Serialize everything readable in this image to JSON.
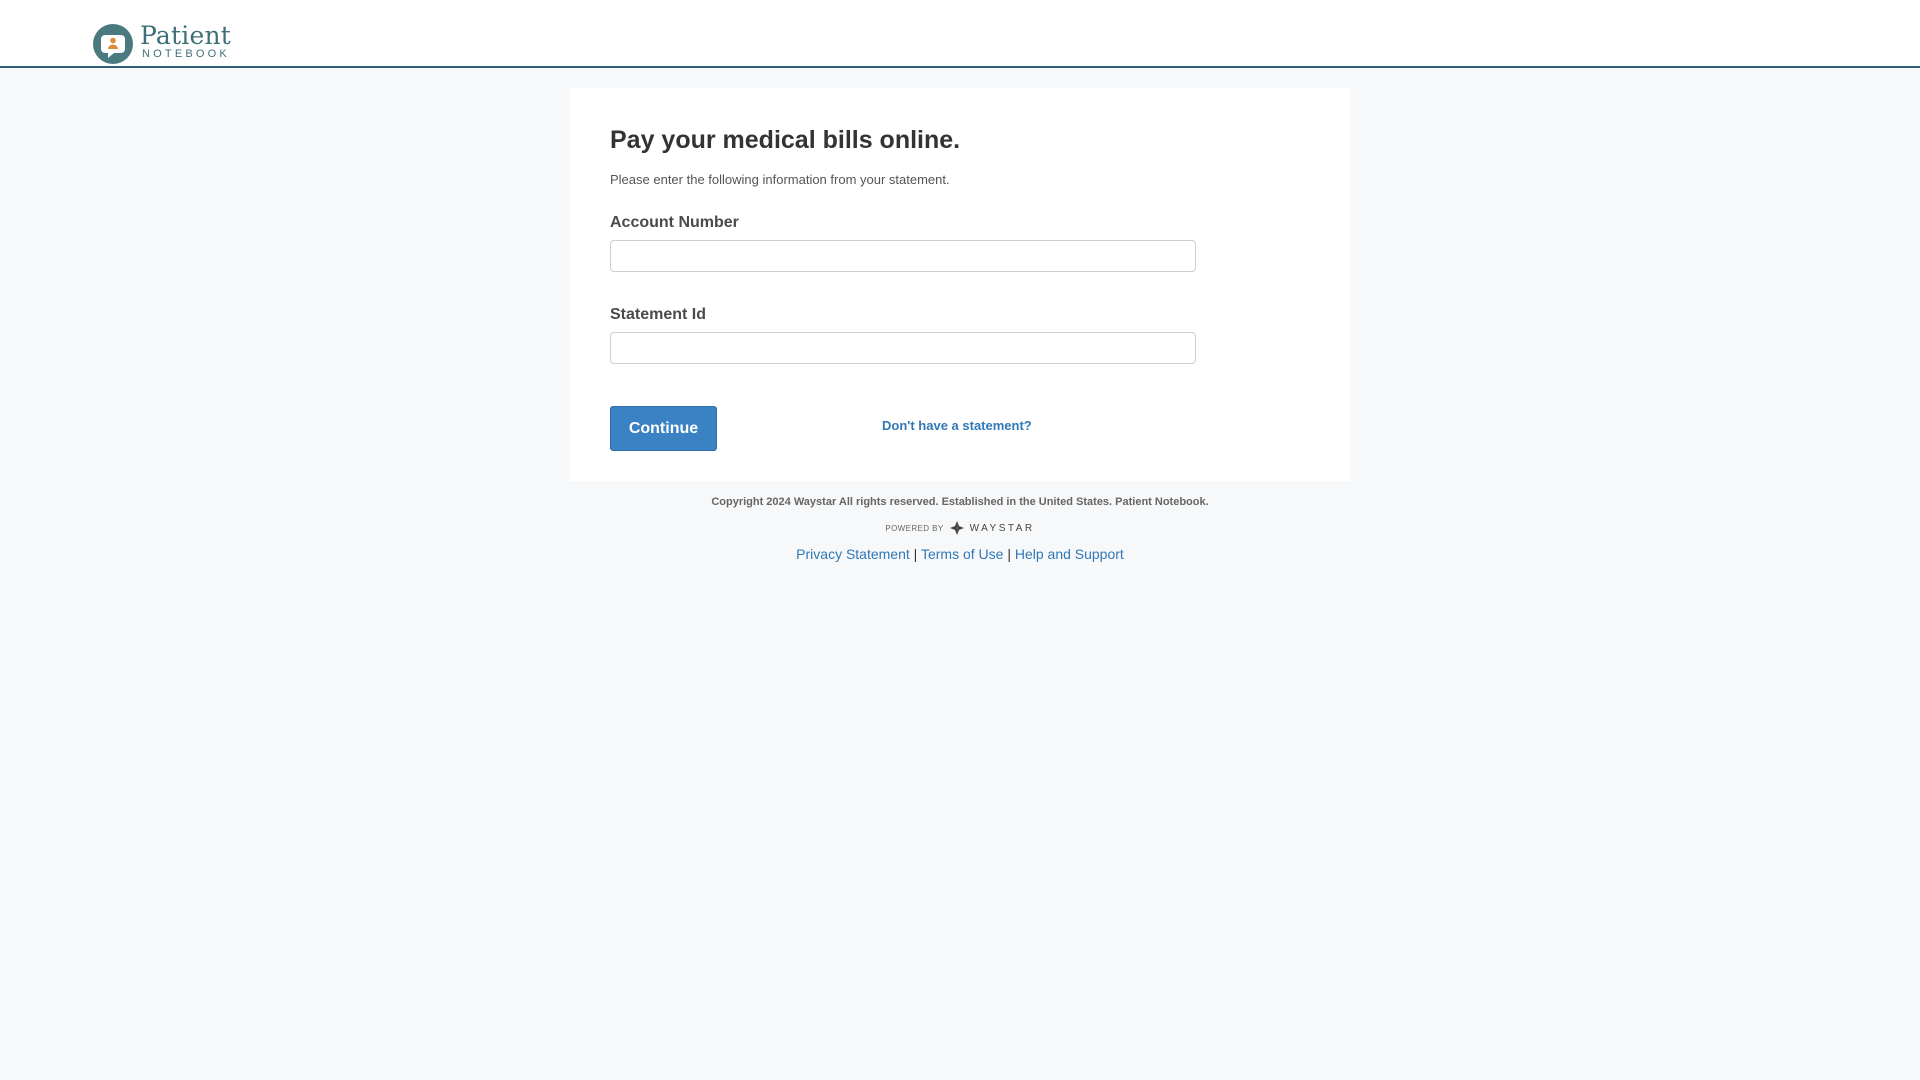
{
  "header": {
    "logo_word": "Patient",
    "logo_sub": "NOTEBOOK",
    "logo_icon": "speech-bubble-person-icon"
  },
  "form": {
    "title": "Pay your medical bills online.",
    "subtitle": "Please enter the following information from your statement.",
    "account_number_label": "Account Number",
    "account_number_value": "",
    "statement_id_label": "Statement Id",
    "statement_id_value": "",
    "continue_label": "Continue",
    "no_statement_link": "Don't have a statement?"
  },
  "footer": {
    "copyright": "Copyright 2024 Waystar All rights reserved. Established in the United States. Patient Notebook.",
    "powered_by": "POWERED BY",
    "brand": "WAYSTAR",
    "links": {
      "privacy": "Privacy Statement",
      "terms": "Terms of Use",
      "help": "Help and Support",
      "separator": "|"
    }
  },
  "colors": {
    "accent": "#3b82c4",
    "link": "#3178b8",
    "header_border": "#2b5f7a",
    "logo_teal": "#4a7a7f",
    "logo_orange": "#e08a3c",
    "background": "#f7f8f9"
  }
}
